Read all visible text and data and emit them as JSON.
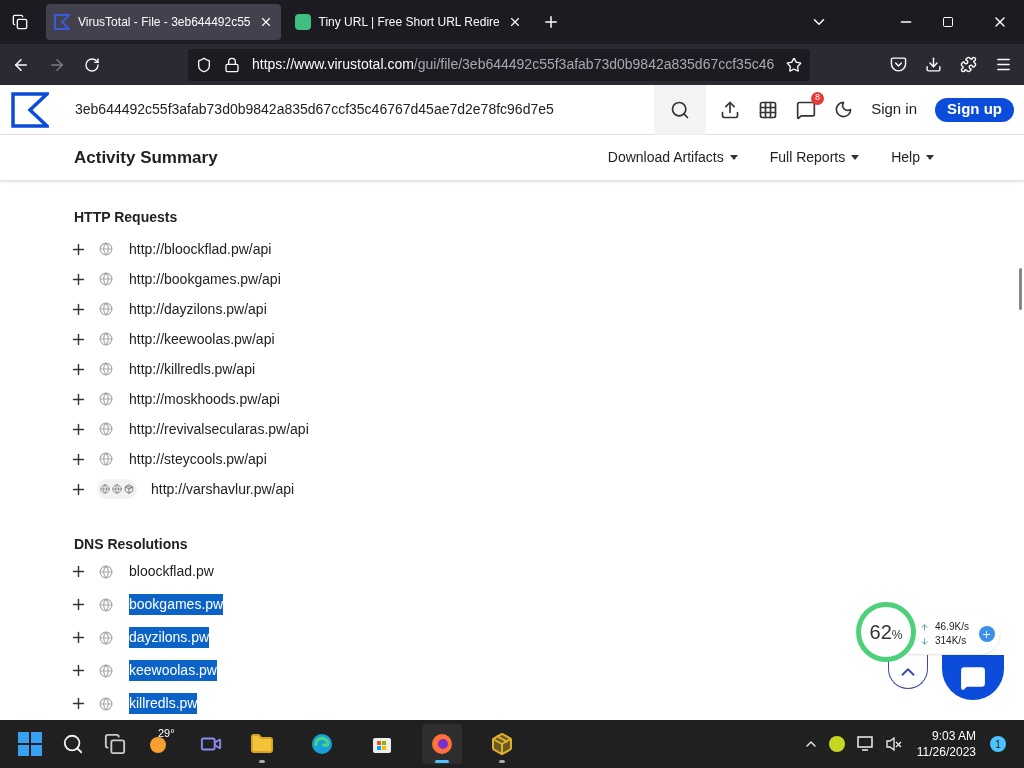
{
  "browser": {
    "tabs": [
      {
        "title": "VirusTotal - File - 3eb644492c55",
        "selected": true,
        "kind": "virustotal"
      },
      {
        "title": "Tiny URL | Free Short URL Redire",
        "selected": false,
        "kind": "tinyurl"
      }
    ],
    "url_host": "https://www.virustotal.com",
    "url_path": "/gui/file/3eb644492c55f3afab73d0b9842a835d67ccf35c46"
  },
  "site": {
    "search_value": "3eb644492c55f3afab73d0b9842a835d67ccf35c46767d45ae7d2e78fc96d7e5",
    "notification_count": "8",
    "sign_in": "Sign in",
    "sign_up": "Sign up"
  },
  "activity": {
    "title": "Activity Summary",
    "menus": [
      "Download Artifacts",
      "Full Reports",
      "Help"
    ]
  },
  "http_requests": {
    "heading": "HTTP Requests",
    "items": [
      {
        "url": "http://bloockflad.pw/api",
        "kind": "single"
      },
      {
        "url": "http://bookgames.pw/api",
        "kind": "single"
      },
      {
        "url": "http://dayzilons.pw/api",
        "kind": "single"
      },
      {
        "url": "http://keewoolas.pw/api",
        "kind": "single"
      },
      {
        "url": "http://killredls.pw/api",
        "kind": "single"
      },
      {
        "url": "http://moskhoods.pw/api",
        "kind": "single"
      },
      {
        "url": "http://revivalsecularas.pw/api",
        "kind": "single"
      },
      {
        "url": "http://steycools.pw/api",
        "kind": "single"
      },
      {
        "url": "http://varshavlur.pw/api",
        "kind": "multi"
      }
    ]
  },
  "dns": {
    "heading": "DNS Resolutions",
    "items": [
      {
        "domain": "bloockflad.pw",
        "selected": false
      },
      {
        "domain": "bookgames.pw",
        "selected": true
      },
      {
        "domain": "dayzilons.pw",
        "selected": true
      },
      {
        "domain": "keewoolas.pw",
        "selected": true
      },
      {
        "domain": "killredls.pw",
        "selected": true
      }
    ]
  },
  "monitor": {
    "percent": "62",
    "percent_sign": "%",
    "upload": "46.9K/s",
    "download": "314K/s"
  },
  "taskbar": {
    "weather_temp": "29°",
    "apps": [
      {
        "kind": "explorer",
        "selected": false,
        "running": true
      },
      {
        "kind": "edge",
        "selected": false,
        "running": false
      },
      {
        "kind": "store",
        "selected": false,
        "running": false
      },
      {
        "kind": "firefox",
        "selected": true,
        "running": true
      },
      {
        "kind": "installer",
        "selected": false,
        "running": true
      }
    ],
    "time": "9:03 AM",
    "date": "11/26/2023",
    "notification_count": "1"
  }
}
